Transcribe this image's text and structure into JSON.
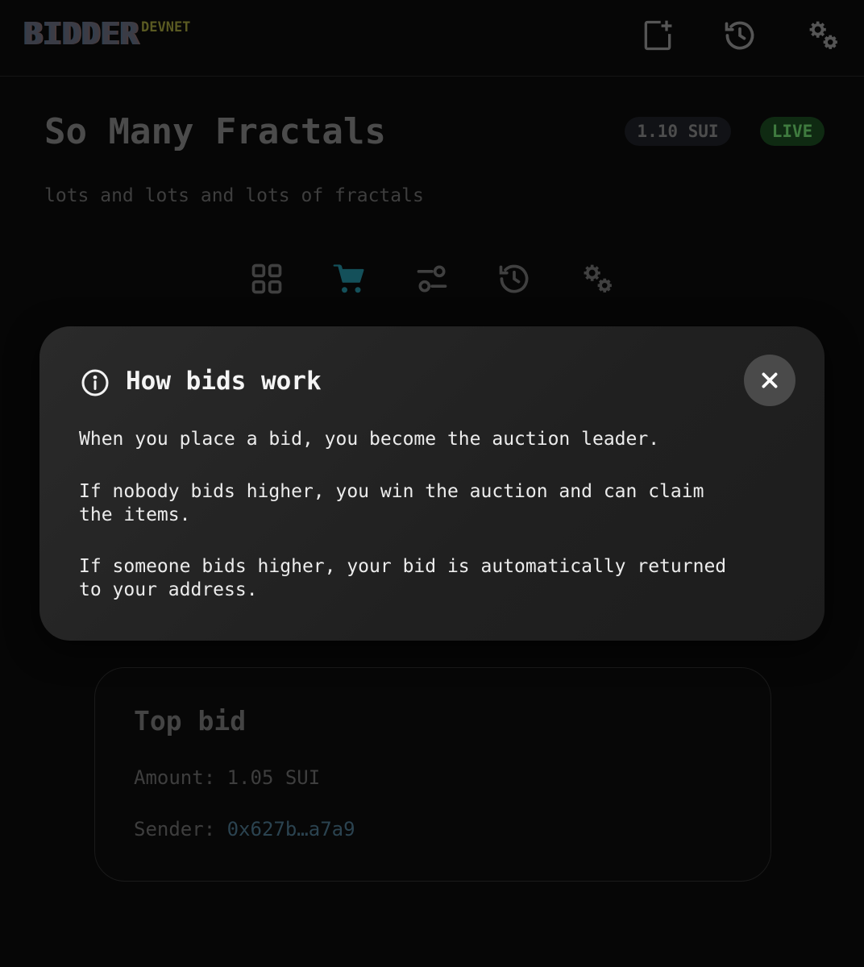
{
  "header": {
    "logo": "BIDDER",
    "network": "DEVNET",
    "icons": [
      "new-auction-icon",
      "history-icon",
      "settings-icon"
    ]
  },
  "auction": {
    "title": "So Many Fractals",
    "price": "1.10 SUI",
    "status": "LIVE",
    "description": "lots and lots and lots of fractals"
  },
  "tabs": {
    "icons": [
      "grid-icon",
      "cart-icon",
      "filter-icon",
      "history-icon",
      "settings-icon"
    ],
    "active": "cart-icon"
  },
  "modal": {
    "title": "How bids work",
    "paragraphs": [
      "When you place a bid, you become the auction leader.",
      "If nobody bids higher, you win the auction and can claim\nthe items.",
      "If someone bids higher, your bid is automatically returned\nto your address."
    ]
  },
  "top_bid": {
    "title": "Top bid",
    "amount_label": "Amount:",
    "amount_value": "1.05 SUI",
    "sender_label": "Sender:",
    "sender_value": "0x627b…a7a9"
  },
  "colors": {
    "background": "#060606",
    "modal_bg": "#242424",
    "live_green": "#3f7b3f",
    "active_tab": "#14505a",
    "network_badge": "#5a5a22"
  }
}
